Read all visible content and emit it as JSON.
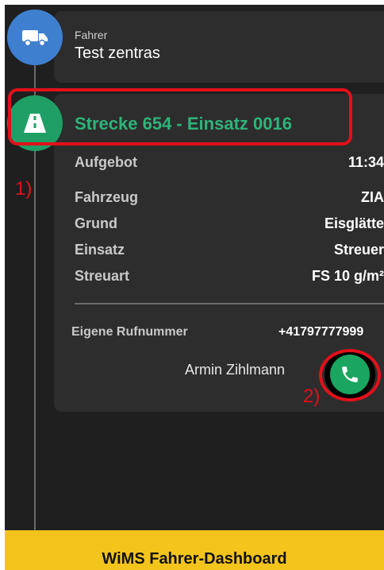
{
  "driver": {
    "label": "Fahrer",
    "name": "Test zentras",
    "icon": "truck-icon",
    "color": "#3f7fcf"
  },
  "mission": {
    "title": "Strecke 654 - Einsatz 0016",
    "icon": "road-icon",
    "color": "#1f9f66",
    "rows": [
      {
        "label": "Aufgebot",
        "value": "11:34"
      },
      {
        "label": "Fahrzeug",
        "value": "ZIA"
      },
      {
        "label": "Grund",
        "value": "Eisglätte"
      },
      {
        "label": "Einsatz",
        "value": "Streuer"
      },
      {
        "label": "Streuart",
        "value": "FS 10 g/m²"
      }
    ],
    "phone_label": "Eigene Rufnummer",
    "phone_number": "+41797777999",
    "contact_name": "Armin Zihlmann",
    "call_icon": "phone-icon"
  },
  "annotations": {
    "one": "1)",
    "two": "2)"
  },
  "footer": {
    "title": "WiMS Fahrer-Dashboard",
    "color": "#f3c41c"
  }
}
